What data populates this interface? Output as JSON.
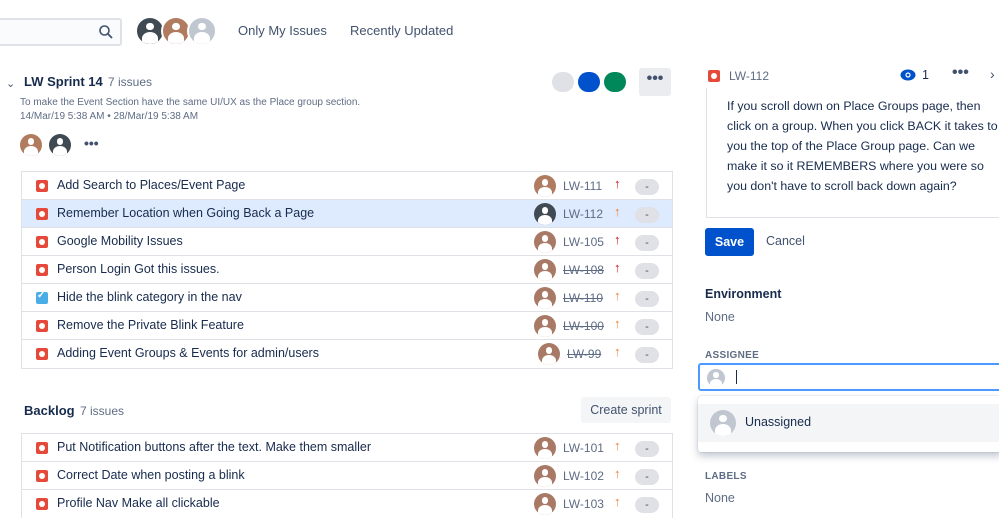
{
  "quick_filters": [
    "Only My Issues",
    "Recently Updated"
  ],
  "sprint": {
    "name": "LW Sprint 14",
    "count": "7 issues",
    "goal": "To make the Event Section have the same UI/UX as the Place group section.",
    "dates": "14/Mar/19 5:38 AM • 28/Mar/19 5:38 AM",
    "more": "•••",
    "status_colors": [
      "#DFE1E6",
      "#0052CC",
      "#00875A"
    ],
    "issues": [
      {
        "type": "bug",
        "summary": "Add Search to Places/Event Page",
        "key": "LW-111",
        "done": false,
        "priority": "high",
        "estimate": "-",
        "avatar": "#B07B5F",
        "selected": false
      },
      {
        "type": "bug",
        "summary": "Remember Location when Going Back a Page",
        "key": "LW-112",
        "done": false,
        "priority": "med",
        "estimate": "-",
        "avatar": "#3F4A52",
        "selected": true
      },
      {
        "type": "bug",
        "summary": "Google Mobility Issues",
        "key": "LW-105",
        "done": false,
        "priority": "high",
        "estimate": "-",
        "avatar": "#A87A66",
        "selected": false
      },
      {
        "type": "bug",
        "summary": "Person Login Got this issues.",
        "key": "LW-108",
        "done": true,
        "priority": "high",
        "estimate": "-",
        "avatar": "#A87A66",
        "selected": false
      },
      {
        "type": "task",
        "summary": "Hide the blink category in the nav",
        "key": "LW-110",
        "done": true,
        "priority": "med",
        "estimate": "-",
        "avatar": "#A87A66",
        "selected": false
      },
      {
        "type": "bug",
        "summary": "Remove the Private Blink Feature",
        "key": "LW-100",
        "done": true,
        "priority": "med",
        "estimate": "-",
        "avatar": "#A87A66",
        "selected": false
      },
      {
        "type": "bug",
        "summary": "Adding Event Groups & Events for admin/users",
        "key": "LW-99",
        "done": true,
        "priority": "med",
        "estimate": "-",
        "avatar": "#A87A66",
        "selected": false
      }
    ]
  },
  "backlog": {
    "name": "Backlog",
    "count": "7 issues",
    "create_sprint": "Create sprint",
    "issues": [
      {
        "type": "bug",
        "summary": "Put Notification buttons after the text. Make them smaller",
        "key": "LW-101",
        "done": false,
        "priority": "med",
        "estimate": "-",
        "avatar": "#A87A66"
      },
      {
        "type": "bug",
        "summary": "Correct Date when posting a blink",
        "key": "LW-102",
        "done": false,
        "priority": "med",
        "estimate": "-",
        "avatar": "#A87A66"
      },
      {
        "type": "bug",
        "summary": "Profile Nav Make all clickable",
        "key": "LW-103",
        "done": false,
        "priority": "med",
        "estimate": "-",
        "avatar": "#A87A66"
      }
    ]
  },
  "detail": {
    "key": "LW-112",
    "watchers": "1",
    "more": "•••",
    "next": "›",
    "description": "If you scroll down on Place Groups page, then click on a group. When you click BACK it takes to you the top of the Place Group page. Can we make it so it REMEMBERS where you were so you don't have to scroll back down again?",
    "save": "Save",
    "cancel": "Cancel",
    "environment_label": "Environment",
    "environment_value": "None",
    "assignee_label": "ASSIGNEE",
    "unassigned": "Unassigned",
    "labels_label": "LABELS",
    "labels_value": "None"
  },
  "colors": {
    "accent": "#0052CC",
    "bug": "#E5493A",
    "task": "#4BADE8",
    "priority_high": "#CD1317",
    "priority_med": "#E97F33"
  }
}
